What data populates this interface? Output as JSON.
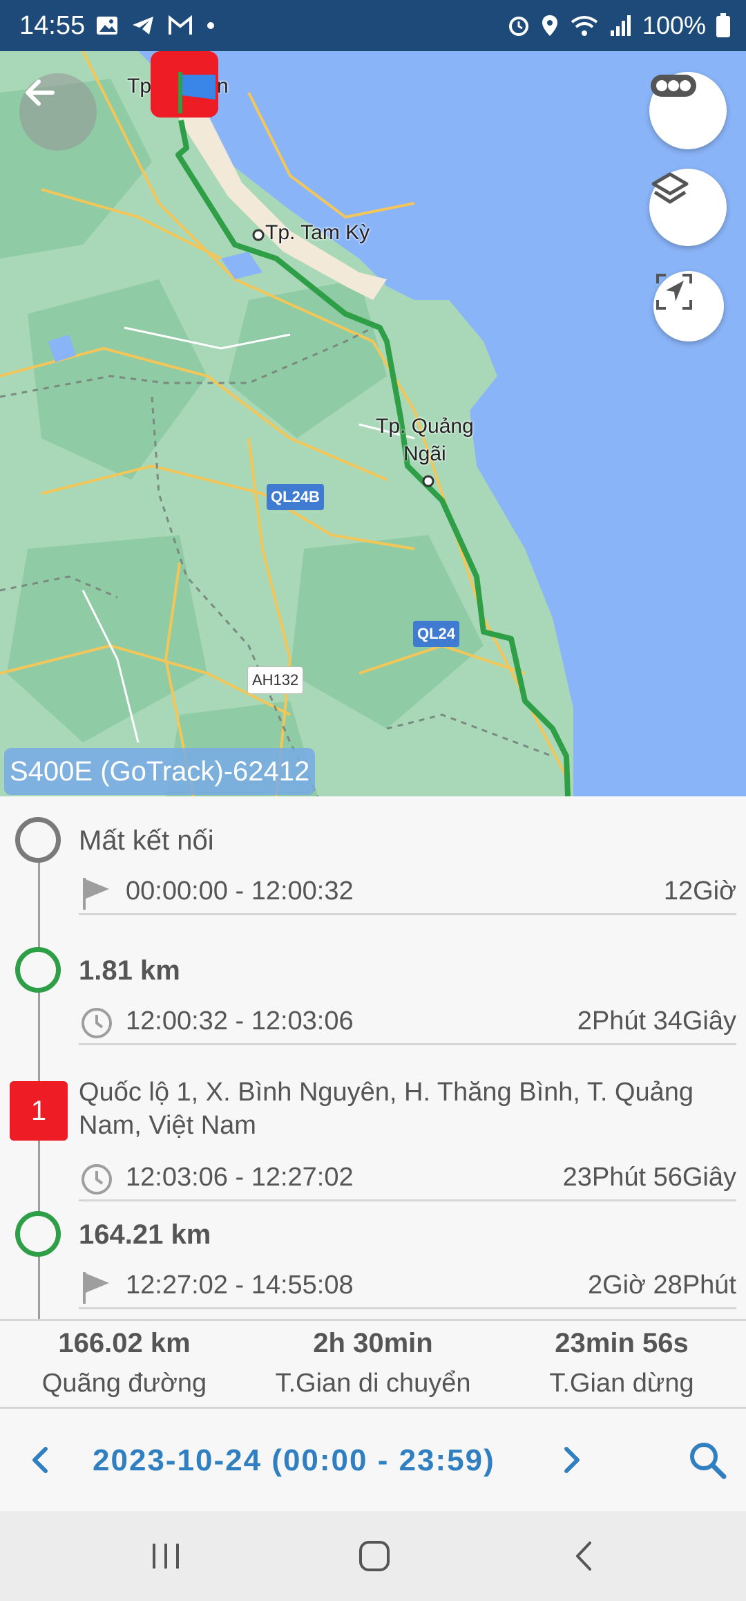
{
  "status_bar": {
    "time": "14:55",
    "battery": "100%"
  },
  "map": {
    "device_label": "S400E (GoTrack)-62412",
    "cities": [
      "Tp. Tam Kỳ",
      "Tp. Quảng",
      "Ngãi",
      "Tp",
      "n"
    ],
    "road_badges": [
      "QL24B",
      "QL24",
      "AH132"
    ],
    "colors": {
      "route": "#2e9e47",
      "sea": "#8ab4f8",
      "land": "#a8d8b8"
    }
  },
  "timeline": {
    "entries": [
      {
        "title": "Mất kết nối",
        "time_range": "00:00:00 - 12:00:32",
        "duration": "12Giờ",
        "icon": "flag-icon"
      },
      {
        "title": "1.81 km",
        "time_range": "12:00:32 - 12:03:06",
        "duration": "2Phút 34Giây",
        "icon": "clock-icon"
      },
      {
        "badge": "1",
        "title": "Quốc lộ 1, X. Bình Nguyên, H. Thăng Bình, T. Quảng Nam, Việt Nam",
        "time_range": "12:03:06 - 12:27:02",
        "duration": "23Phút 56Giây",
        "icon": "clock-icon"
      },
      {
        "title": "164.21 km",
        "time_range": "12:27:02 - 14:55:08",
        "duration": "2Giờ 28Phút",
        "icon": "flag-icon"
      }
    ]
  },
  "summary": {
    "distance": {
      "value": "166.02 km",
      "label": "Quãng đường"
    },
    "moving": {
      "value": "2h 30min",
      "label": "T.Gian di chuyển"
    },
    "stopped": {
      "value": "23min 56s",
      "label": "T.Gian dừng"
    }
  },
  "date_bar": {
    "date_range": "2023-10-24 (00:00 - 23:59)",
    "accent": "#2f7fc1"
  }
}
